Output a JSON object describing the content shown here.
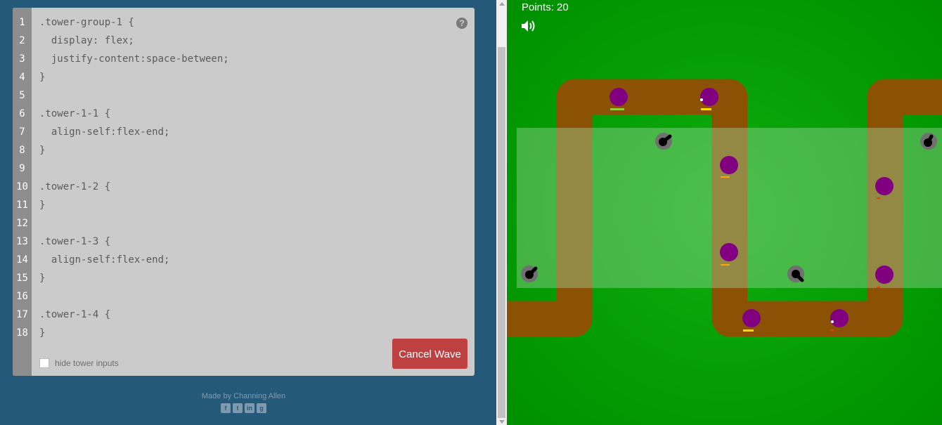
{
  "editor": {
    "line_numbers": [
      "1",
      "2",
      "3",
      "4",
      "5",
      "6",
      "7",
      "8",
      "9",
      "10",
      "11",
      "12",
      "13",
      "14",
      "15",
      "16",
      "17",
      "18"
    ],
    "code_lines": [
      ".tower-group-1 {",
      "  display: flex;",
      "  justify-content:space-between;",
      "}",
      "",
      ".tower-1-1 {",
      "  align-self:flex-end;",
      "}",
      "",
      ".tower-1-2 {",
      "}",
      "",
      ".tower-1-3 {",
      "  align-self:flex-end;",
      "}",
      "",
      ".tower-1-4 {",
      "}"
    ],
    "help_icon": "?",
    "cancel_button": "Cancel Wave",
    "hide_tower_inputs": "hide tower inputs",
    "hide_tower_inputs_checked": false
  },
  "footer": {
    "credit": "Made by Channing Allen",
    "social_icons": [
      "facebook-icon",
      "twitter-icon",
      "linkedin-icon",
      "github-icon"
    ]
  },
  "game": {
    "points_label": "Points: 20",
    "sound_icon": "speaker-icon",
    "colors": {
      "grass": "#049e04",
      "path": "#8b5205",
      "tower_zone": "rgba(150,210,150,0.45)",
      "enemy": "#800080",
      "tower": "#6a6a6a"
    },
    "enemies": [
      {
        "health_color": "#9acd32"
      },
      {
        "health_color": "#ffd700"
      },
      {
        "health_color": "#ffa500"
      },
      {
        "health_color": "#ff3300"
      },
      {
        "health_color": "#ffa500"
      },
      {
        "health_color": "#ff3300"
      },
      {
        "health_color": "#ffd700"
      },
      {
        "health_color": "#ff3300"
      }
    ]
  }
}
